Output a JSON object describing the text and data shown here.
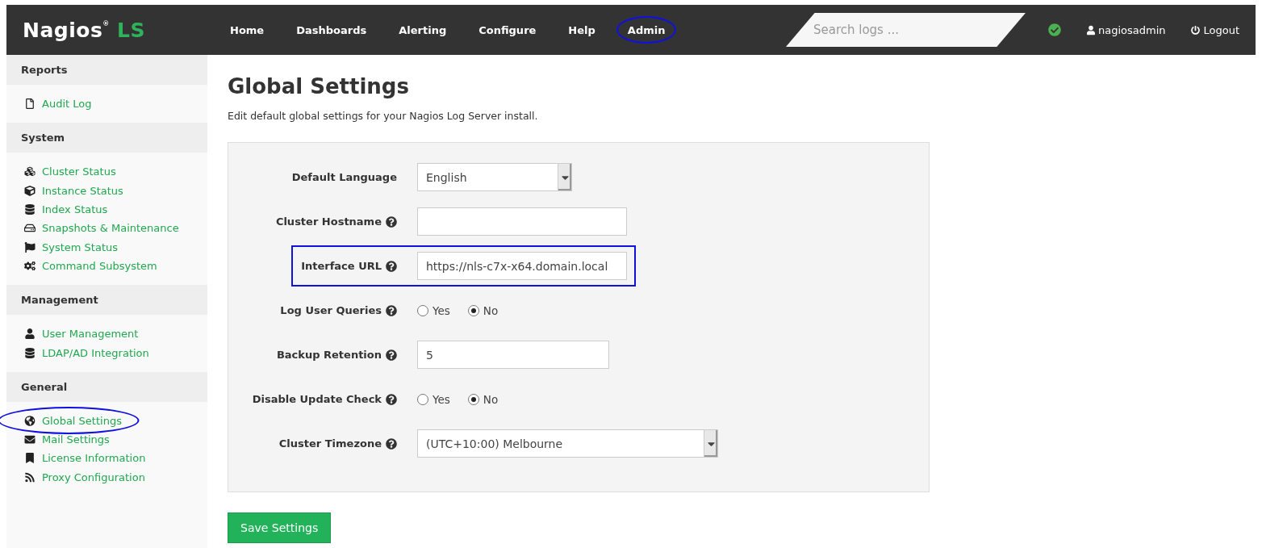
{
  "navbar": {
    "logo": {
      "name": "Nagios",
      "mark": "®",
      "product": "LS"
    },
    "items": [
      {
        "label": "Home",
        "highlighted": false
      },
      {
        "label": "Dashboards",
        "highlighted": false
      },
      {
        "label": "Alerting",
        "highlighted": false
      },
      {
        "label": "Configure",
        "highlighted": false
      },
      {
        "label": "Help",
        "highlighted": false
      },
      {
        "label": "Admin",
        "highlighted": true
      }
    ],
    "search": {
      "placeholder": "Search logs ..."
    },
    "user": "nagiosadmin",
    "logout": "Logout"
  },
  "sidebar": [
    {
      "title": "Reports",
      "items": [
        {
          "label": "Audit Log",
          "highlighted": false
        }
      ]
    },
    {
      "title": "System",
      "items": [
        {
          "label": "Cluster Status",
          "highlighted": false
        },
        {
          "label": "Instance Status",
          "highlighted": false
        },
        {
          "label": "Index Status",
          "highlighted": false
        },
        {
          "label": "Snapshots & Maintenance",
          "highlighted": false
        },
        {
          "label": "System Status",
          "highlighted": false
        },
        {
          "label": "Command Subsystem",
          "highlighted": false
        }
      ]
    },
    {
      "title": "Management",
      "items": [
        {
          "label": "User Management",
          "highlighted": false
        },
        {
          "label": "LDAP/AD Integration",
          "highlighted": false
        }
      ]
    },
    {
      "title": "General",
      "items": [
        {
          "label": "Global Settings",
          "highlighted": true
        },
        {
          "label": "Mail Settings",
          "highlighted": false
        },
        {
          "label": "License Information",
          "highlighted": false
        },
        {
          "label": "Proxy Configuration",
          "highlighted": false
        }
      ]
    }
  ],
  "page": {
    "title": "Global Settings",
    "description": "Edit default global settings for your Nagios Log Server install."
  },
  "fields": [
    {
      "kind": "select",
      "label": "Default Language",
      "help": false,
      "value": "English",
      "highlighted": false
    },
    {
      "kind": "text",
      "label": "Cluster Hostname",
      "help": true,
      "highlighted": false
    },
    {
      "kind": "text",
      "label": "Interface URL",
      "help": true,
      "value": "https://nls-c7x-x64.domain.local",
      "highlighted": true
    },
    {
      "kind": "radio",
      "label": "Log User Queries",
      "help": true,
      "options": [
        {
          "label": "Yes",
          "selected": false
        },
        {
          "label": "No",
          "selected": true
        }
      ],
      "highlighted": false
    },
    {
      "kind": "text",
      "label": "Backup Retention",
      "help": true,
      "value": "5",
      "highlighted": false
    },
    {
      "kind": "radio",
      "label": "Disable Update Check",
      "help": true,
      "options": [
        {
          "label": "Yes",
          "selected": false
        },
        {
          "label": "No",
          "selected": true
        }
      ],
      "highlighted": false
    },
    {
      "kind": "select",
      "label": "Cluster Timezone",
      "help": true,
      "value": "(UTC+10:00) Melbourne",
      "highlighted": false
    }
  ],
  "save_button": "Save Settings"
}
